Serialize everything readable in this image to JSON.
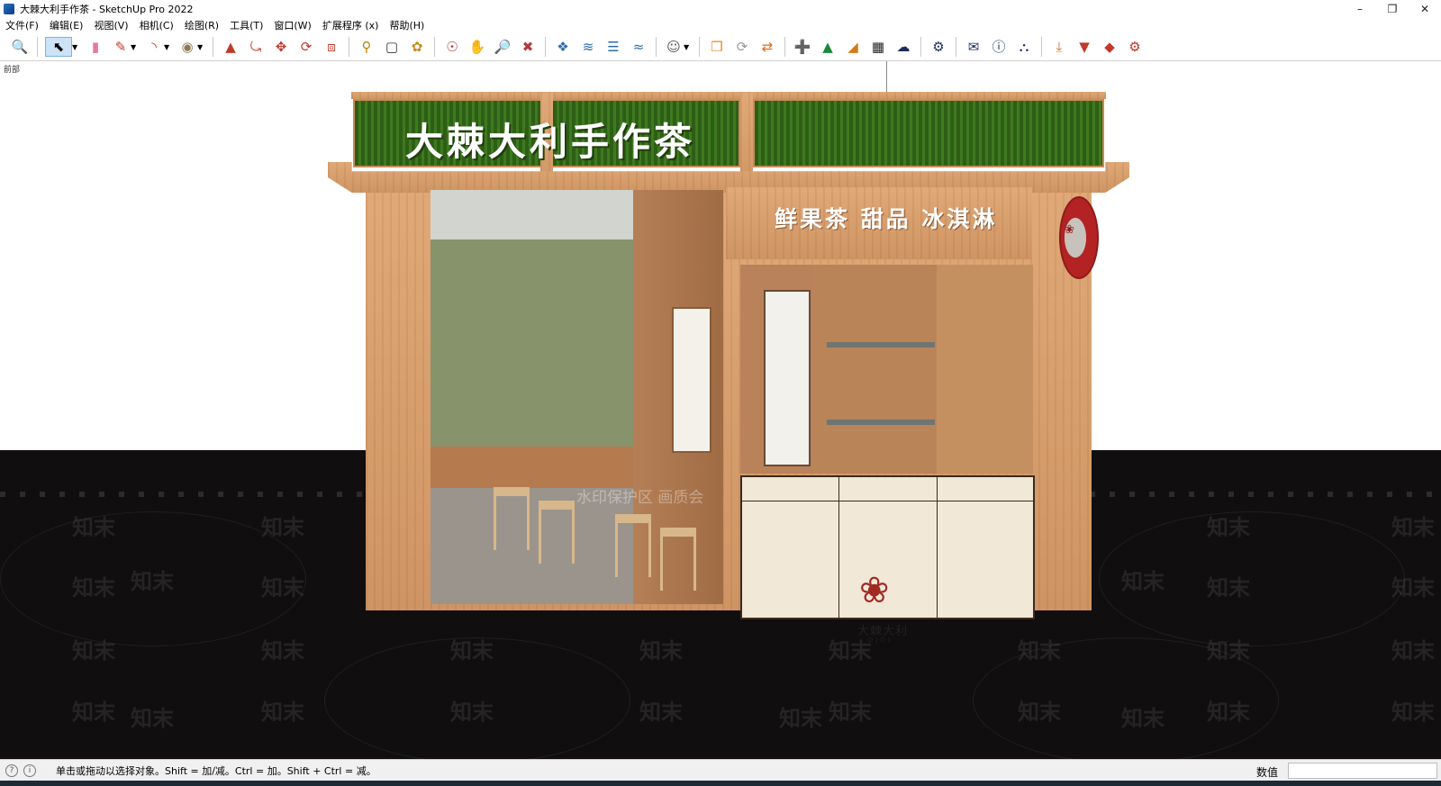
{
  "window": {
    "title": "大棘大利手作茶 - SketchUp Pro 2022",
    "minimize": "–",
    "maximize": "❐",
    "close": "✕"
  },
  "menu": [
    "文件(F)",
    "编辑(E)",
    "视图(V)",
    "相机(C)",
    "绘图(R)",
    "工具(T)",
    "窗口(W)",
    "扩展程序 (x)",
    "帮助(H)"
  ],
  "toolbar": {
    "icons": [
      "zoom-icon",
      "select-icon",
      "eraser-icon",
      "pencil-icon",
      "arc-icon",
      "paint-bucket-icon",
      "push-pull-icon",
      "follow-me-icon",
      "move-icon",
      "rotate-icon",
      "scale-icon",
      "tape-measure-icon",
      "text-icon",
      "paint-icon",
      "orbit-icon",
      "pan-icon",
      "zoom-window-icon",
      "zoom-extents-icon",
      "layers-icon",
      "sandbox-icon",
      "stamp-icon",
      "drape-icon",
      "user-icon",
      "warehouse-icon",
      "refresh-icon",
      "share-icon",
      "add-icon",
      "tree-icon",
      "styles-icon",
      "pattern-icon",
      "cloud-upload-icon",
      "settings-icon",
      "mail-icon",
      "info-icon",
      "cart-icon",
      "import-icon",
      "export-icon",
      "ruby-icon",
      "gear-icon"
    ]
  },
  "viewport": {
    "view_label": "前部",
    "sign_title": "大棘大利手作茶",
    "band_text": "鲜果茶  甜品  冰淇淋",
    "logo_cn": "大棘大利",
    "logo_en": "DJDL",
    "watermark": "知末",
    "watermark_notice": "水印保护区  画质会"
  },
  "status": {
    "hint": "单击或拖动以选择对象。Shift = 加/减。Ctrl = 加。Shift + Ctrl = 减。",
    "measurements_label": "数值",
    "measurements_value": ""
  }
}
